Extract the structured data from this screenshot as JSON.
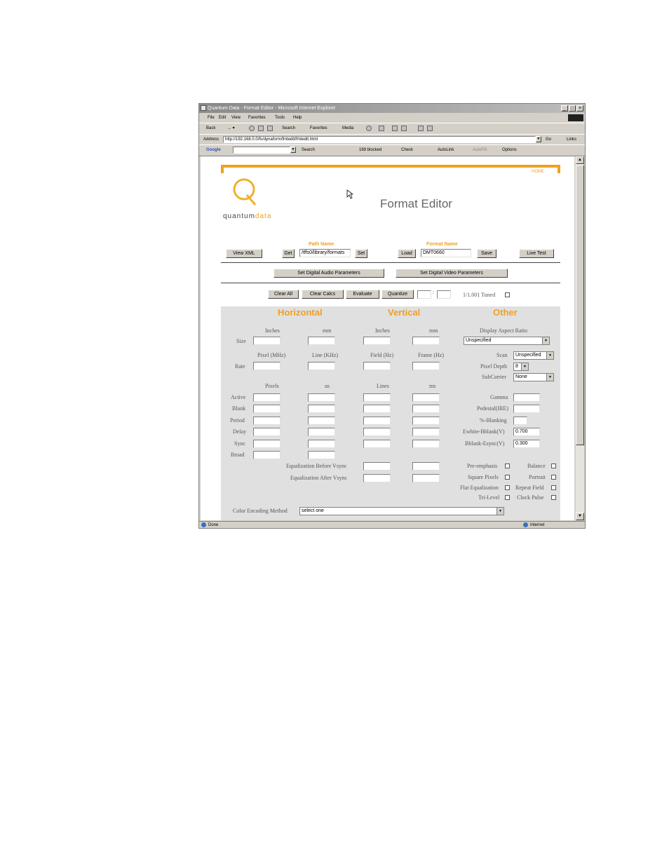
{
  "window": {
    "title": "Quantum Data - Format Editor - Microsoft Internet Explorer",
    "menu": [
      "File",
      "Edit",
      "View",
      "Favorites",
      "Tools",
      "Help"
    ],
    "toolbar": {
      "back": "Back",
      "search": "Search",
      "favorites": "Favorites",
      "media": "Media"
    },
    "address": {
      "label": "Address",
      "url": "http://192.168.0.0/fs/dynaform/fmtedit/fmtedit.html",
      "go": "Go",
      "links": "Links"
    },
    "google": {
      "logo": "Google",
      "search": "Search",
      "blocked": "169 blocked",
      "check": "Check",
      "autolink": "AutoLink",
      "autofill": "AutoFill",
      "options": "Options"
    },
    "status": {
      "left": "Done",
      "right": "Internet"
    }
  },
  "page": {
    "home_link": "HOME",
    "logo_text": {
      "part1": "quantum",
      "part2": "data"
    },
    "title": "Format Editor",
    "path": {
      "label": "Path Name",
      "value": "/tffs0/library/formats",
      "get": "Get",
      "set": "Set"
    },
    "format": {
      "label": "Format Name",
      "value": "DMT0660",
      "load": "Load",
      "save": "Save"
    },
    "view_xml": "View XML",
    "live_test": "Live Test",
    "set_audio": "Set Digital Audio Parameters",
    "set_video": "Set Digital Video Parameters",
    "clear_all": "Clear All",
    "clear_calcs": "Clear Calcs",
    "evaluate": "Evaluate",
    "quantize": "Quantize",
    "tuned_label": "1/1.001 Tuned",
    "sections": {
      "horizontal": "Horizontal",
      "vertical": "Vertical",
      "other": "Other"
    },
    "size": {
      "row": "Size",
      "h_inches": "Inches",
      "h_mm": "mm",
      "v_inches": "Inches",
      "v_mm": "mm"
    },
    "rate": {
      "row": "Rate",
      "pixel": "Pixel (MHz)",
      "line": "Line (KHz)",
      "field": "Field (Hz)",
      "frame": "Frame (Hz)"
    },
    "timing_headers": {
      "pixels": "Pixels",
      "us": "us",
      "lines": "Lines",
      "ms": "ms"
    },
    "timing_rows": [
      "Active",
      "Blank",
      "Period",
      "Delay",
      "Sync",
      "Broad"
    ],
    "equalization": {
      "before": "Equalization Before Vsync",
      "after": "Equalization After Vsync"
    },
    "other": {
      "aspect_label": "Display Aspect Ratio",
      "aspect_value": "Unspecified",
      "scan_label": "Scan",
      "scan_value": "Unspecified",
      "pixel_depth_label": "Pixel Depth",
      "pixel_depth_value": "8",
      "subcarrier_label": "SubCarrier",
      "subcarrier_value": "None",
      "gamma_label": "Gamma",
      "pedestal_label": "Pedestal(IRE)",
      "blanking_label": "%-Blanking",
      "ewhite_label": "Ewhite-Bblank(V)",
      "ewhite_value": "0.700",
      "bblank_label": "Bblank-Esync(V)",
      "bblank_value": "0.300"
    },
    "checkboxes": {
      "pre_emphasis": "Pre-emphasis",
      "balance": "Balance",
      "square_pixels": "Square Pixels",
      "portrait": "Portrait",
      "flat_equalization": "Flat Equalization",
      "repeat_field": "Repeat Field",
      "tri_level": "Tri-Level",
      "clock_pulse": "Clock Pulse"
    },
    "color_encoding": {
      "label": "Color Encoding Method",
      "value": "select one"
    }
  },
  "colors": {
    "accent": "#f0a020",
    "panel": "#e0e0e0"
  }
}
